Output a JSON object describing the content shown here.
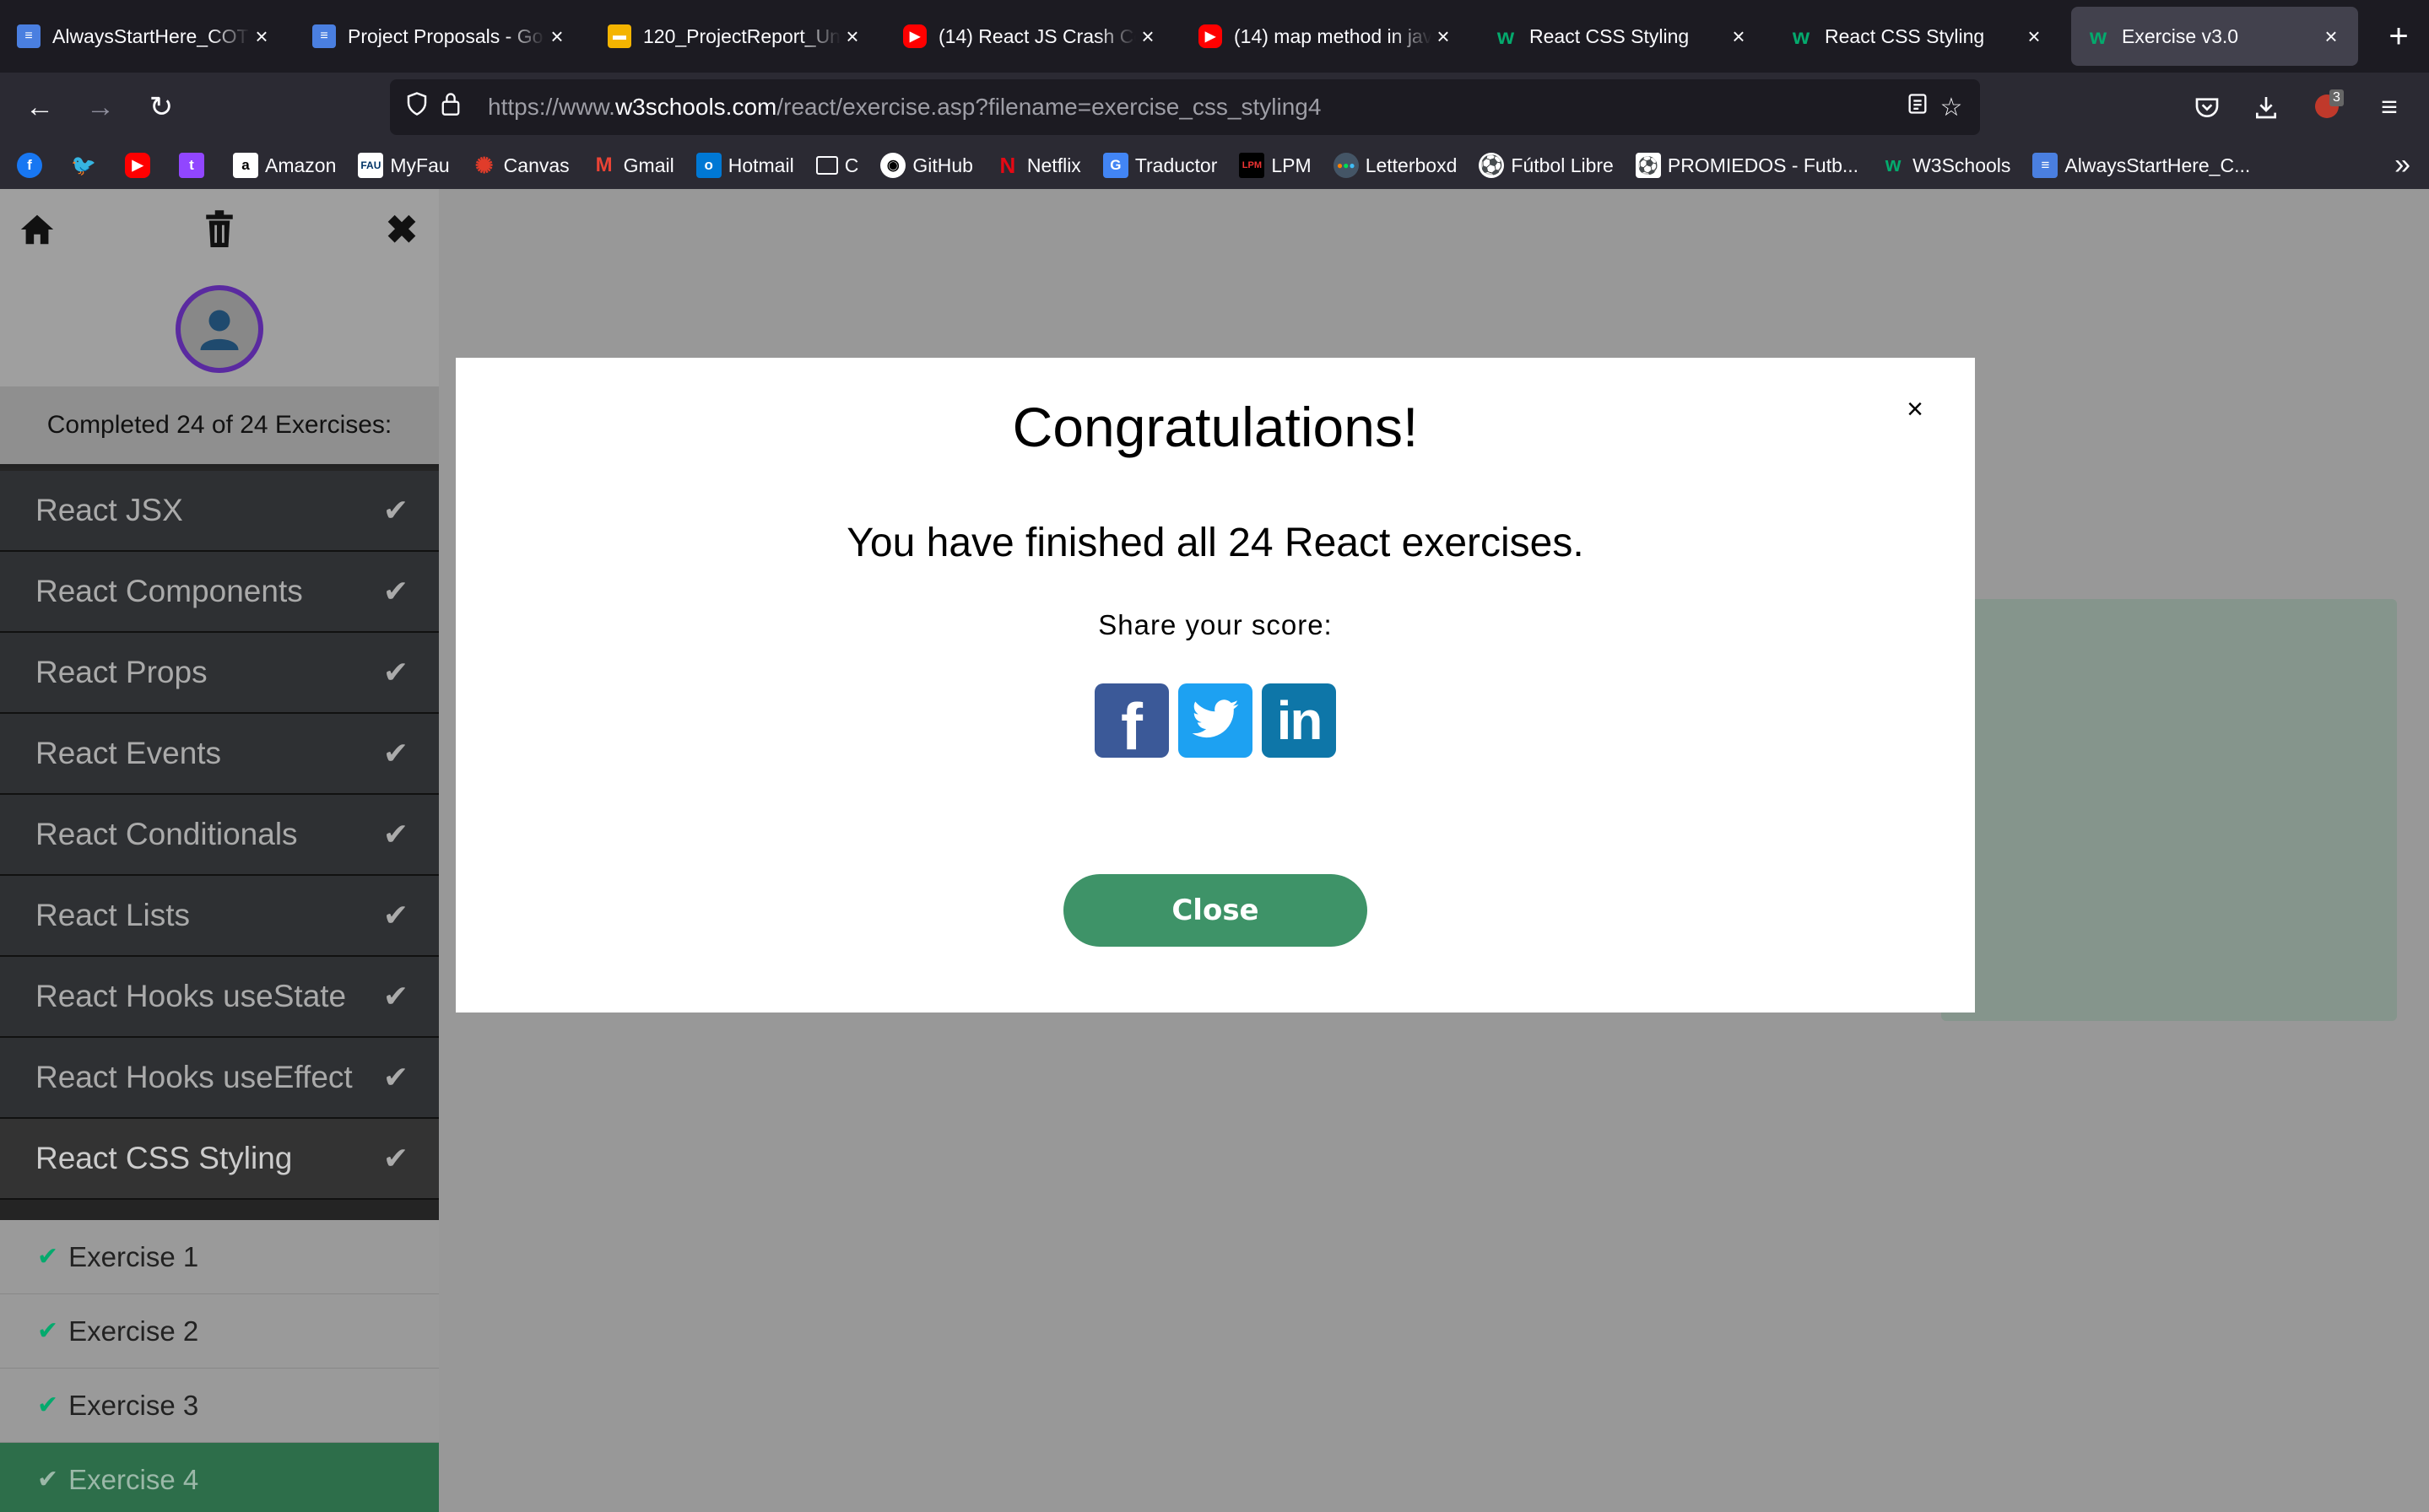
{
  "tabs": [
    {
      "title": "AlwaysStartHere_COT",
      "favicon": "docs-icon"
    },
    {
      "title": "Project Proposals - Go",
      "favicon": "docs-icon"
    },
    {
      "title": "120_ProjectReport_Un",
      "favicon": "slides-icon"
    },
    {
      "title": "(14) React JS Crash Co",
      "favicon": "youtube-icon"
    },
    {
      "title": "(14) map method in jav",
      "favicon": "youtube-icon"
    },
    {
      "title": "React CSS Styling",
      "favicon": "w3schools-icon"
    },
    {
      "title": "React CSS Styling",
      "favicon": "w3schools-icon"
    },
    {
      "title": "Exercise v3.0",
      "favicon": "w3schools-icon",
      "active": true
    }
  ],
  "address_bar": {
    "prefix": "https://www.",
    "domain": "w3schools.com",
    "path": "/react/exercise.asp?filename=exercise_css_styling4"
  },
  "extension_badge": "3",
  "bookmarks": [
    {
      "label": "",
      "icon": "facebook-icon"
    },
    {
      "label": "",
      "icon": "twitter-icon"
    },
    {
      "label": "",
      "icon": "youtube-icon"
    },
    {
      "label": "",
      "icon": "twitch-icon"
    },
    {
      "label": "Amazon",
      "icon": "amazon-icon"
    },
    {
      "label": "MyFau",
      "icon": "myfau-icon"
    },
    {
      "label": "Canvas",
      "icon": "canvas-icon"
    },
    {
      "label": "Gmail",
      "icon": "gmail-icon"
    },
    {
      "label": "Hotmail",
      "icon": "outlook-icon"
    },
    {
      "label": "C",
      "icon": "folder-icon"
    },
    {
      "label": "GitHub",
      "icon": "github-icon"
    },
    {
      "label": "Netflix",
      "icon": "netflix-icon"
    },
    {
      "label": "Traductor",
      "icon": "translate-icon"
    },
    {
      "label": "LPM",
      "icon": "lpm-icon"
    },
    {
      "label": "Letterboxd",
      "icon": "letterboxd-icon"
    },
    {
      "label": "Fútbol Libre",
      "icon": "soccer-icon"
    },
    {
      "label": "PROMIEDOS - Futb...",
      "icon": "promiedos-icon"
    },
    {
      "label": "W3Schools",
      "icon": "w3schools-icon"
    },
    {
      "label": "AlwaysStartHere_C...",
      "icon": "docs-icon"
    }
  ],
  "sidebar": {
    "completed_text": "Completed 24 of 24 Exercises:",
    "topics": [
      "React JSX",
      "React Components",
      "React Props",
      "React Events",
      "React Conditionals",
      "React Lists",
      "React Hooks useState",
      "React Hooks useEffect",
      "React CSS Styling"
    ],
    "exercises": [
      "Exercise 1",
      "Exercise 2",
      "Exercise 3",
      "Exercise 4"
    ]
  },
  "modal": {
    "title": "Congratulations!",
    "message": "You have finished all 24 React exercises.",
    "share_label": "Share your score:",
    "close_label": "Close",
    "close_x": "×"
  },
  "colors": {
    "accent_green": "#04aa6d",
    "close_button": "#3e9368",
    "facebook": "#3b5998",
    "twitter": "#1da1f2",
    "linkedin": "#0e76a8"
  }
}
